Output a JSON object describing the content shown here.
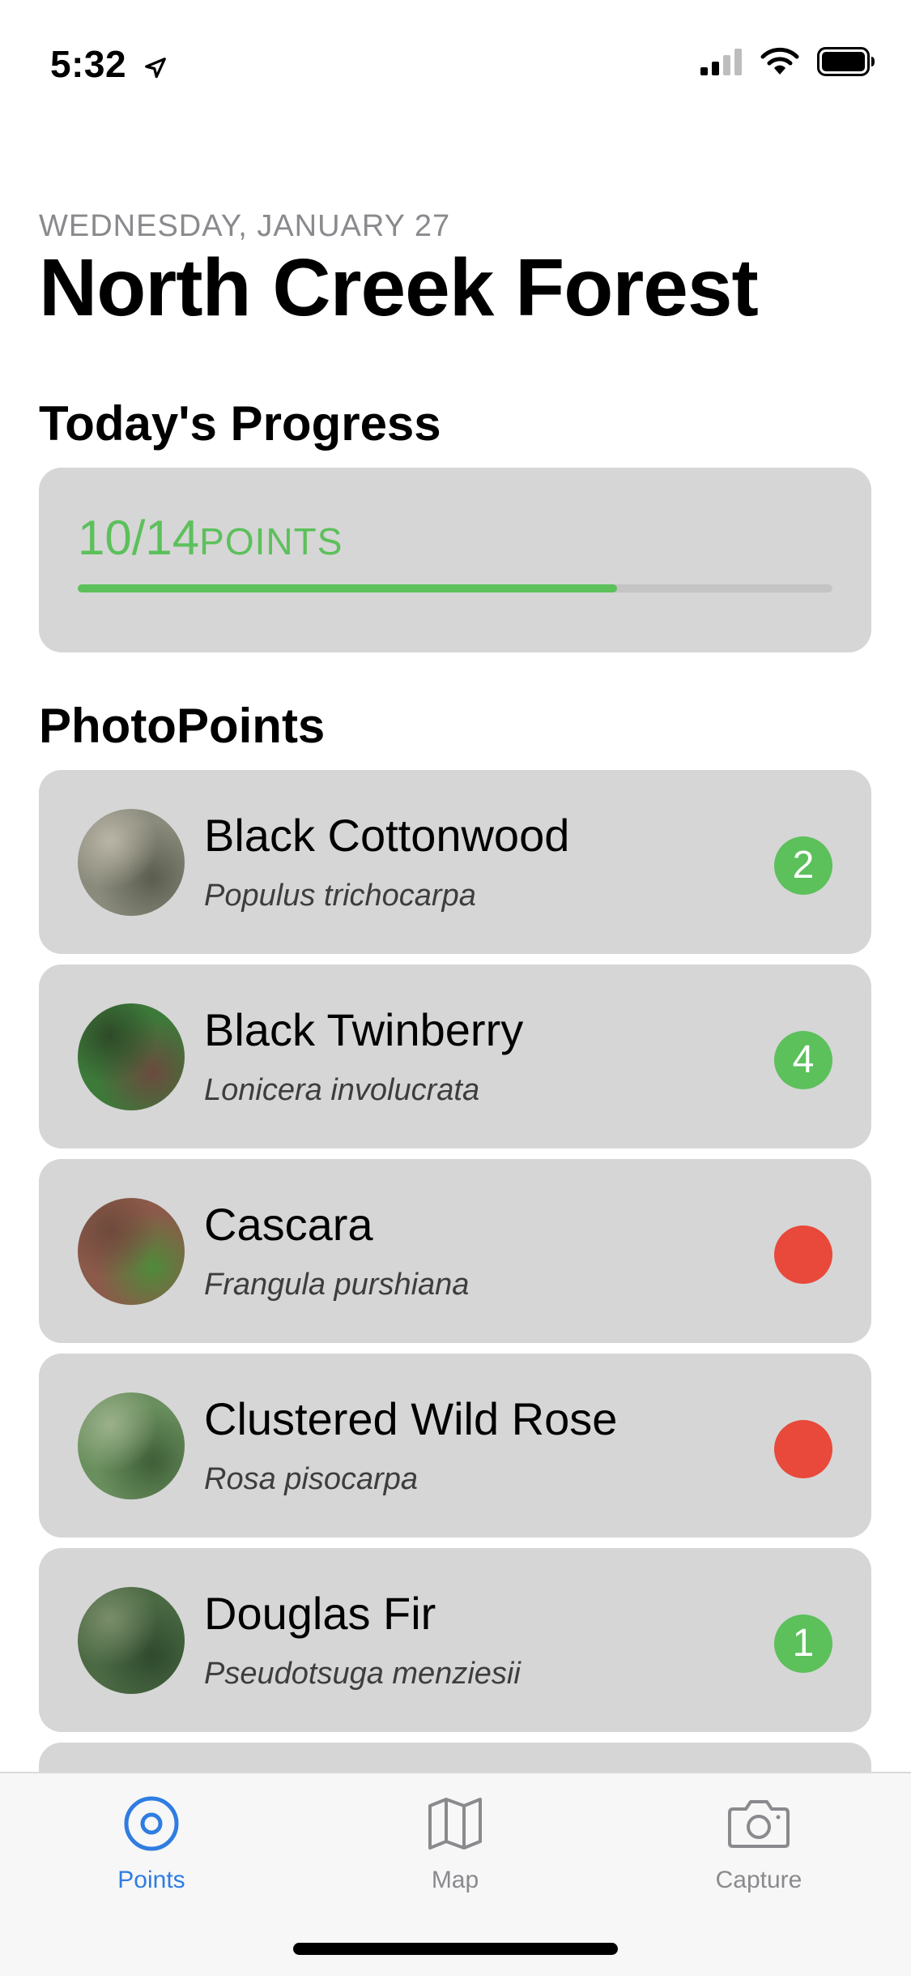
{
  "status_bar": {
    "time": "5:32",
    "icons": [
      "location-arrow-icon",
      "cellular-signal-icon",
      "wifi-icon",
      "battery-icon"
    ]
  },
  "header": {
    "date": "WEDNESDAY, JANUARY 27",
    "title": "North Creek Forest"
  },
  "progress": {
    "section_title": "Today's Progress",
    "count_text": "10/14",
    "unit_text": "POINTS",
    "completed": 10,
    "total": 14,
    "color": "#5cc05b"
  },
  "photopoints": {
    "section_title": "PhotoPoints",
    "items": [
      {
        "common": "Black Cottonwood",
        "scientific": "Populus trichocarpa",
        "badge": "2",
        "status": "done",
        "thumb_colors": [
          "#8a8b7c",
          "#5b5e4f",
          "#b9b4a6"
        ]
      },
      {
        "common": "Black Twinberry",
        "scientific": "Lonicera involucrata",
        "badge": "4",
        "status": "done",
        "thumb_colors": [
          "#3d7a3a",
          "#6b4a3e",
          "#2e4a28"
        ]
      },
      {
        "common": "Cascara",
        "scientific": "Frangula purshiana",
        "badge": "",
        "status": "pending",
        "thumb_colors": [
          "#8c5a4a",
          "#4f8a3a",
          "#6e4a3c"
        ]
      },
      {
        "common": "Clustered Wild Rose",
        "scientific": "Rosa pisocarpa",
        "badge": "",
        "status": "pending",
        "thumb_colors": [
          "#6a8f5e",
          "#3f5f38",
          "#9bb08a"
        ]
      },
      {
        "common": "Douglas Fir",
        "scientific": "Pseudotsuga menziesii",
        "badge": "1",
        "status": "done",
        "thumb_colors": [
          "#4b6a44",
          "#2f4a2e",
          "#7a8c6a"
        ]
      }
    ]
  },
  "status_colors": {
    "done": "#5cc05b",
    "pending": "#e8493a"
  },
  "tabs": [
    {
      "label": "Points",
      "icon": "target-circle-icon",
      "active": true
    },
    {
      "label": "Map",
      "icon": "map-icon",
      "active": false
    },
    {
      "label": "Capture",
      "icon": "camera-icon",
      "active": false
    }
  ],
  "colors": {
    "accent": "#2f7de1",
    "inactive": "#8a8a8e",
    "card": "#d6d6d6"
  }
}
